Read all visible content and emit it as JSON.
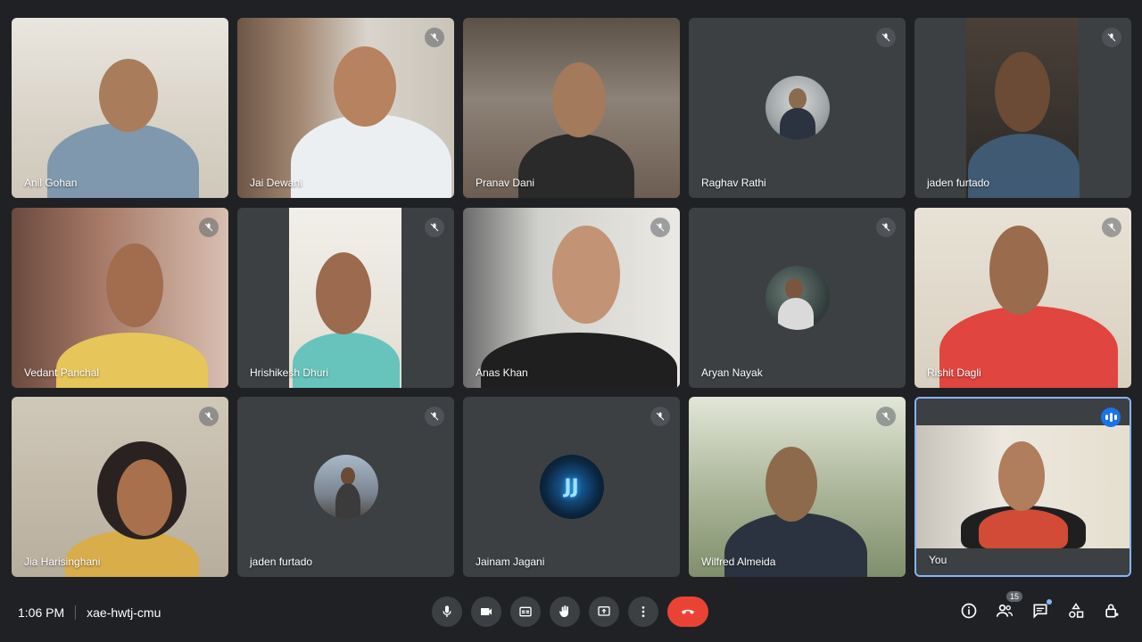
{
  "participants": [
    {
      "name": "Anil Gohan",
      "muted": false
    },
    {
      "name": "Jai Dewani",
      "muted": true
    },
    {
      "name": "Pranav Dani",
      "muted": false
    },
    {
      "name": "Raghav Rathi",
      "muted": true
    },
    {
      "name": "jaden furtado",
      "muted": true
    },
    {
      "name": "Vedant Panchal",
      "muted": true
    },
    {
      "name": "Hrishikesh Dhuri",
      "muted": true
    },
    {
      "name": "Anas Khan",
      "muted": true
    },
    {
      "name": "Aryan Nayak",
      "muted": true
    },
    {
      "name": "Rishit Dagli",
      "muted": true
    },
    {
      "name": "Jia Harisinghani",
      "muted": true
    },
    {
      "name": "jaden furtado",
      "muted": true
    },
    {
      "name": "Jainam Jagani",
      "muted": true
    },
    {
      "name": "Wilfred Almeida",
      "muted": true
    },
    {
      "name": "You",
      "muted": false
    }
  ],
  "bottom_bar": {
    "time": "1:06 PM",
    "meeting_code": "xae-hwtj-cmu",
    "people_count": "15"
  },
  "avatar_text": {
    "jainam": "JJ"
  },
  "colors": {
    "background": "#202124",
    "tile": "#3c4043",
    "end_call": "#ea4335",
    "accent": "#8ab4f8"
  }
}
